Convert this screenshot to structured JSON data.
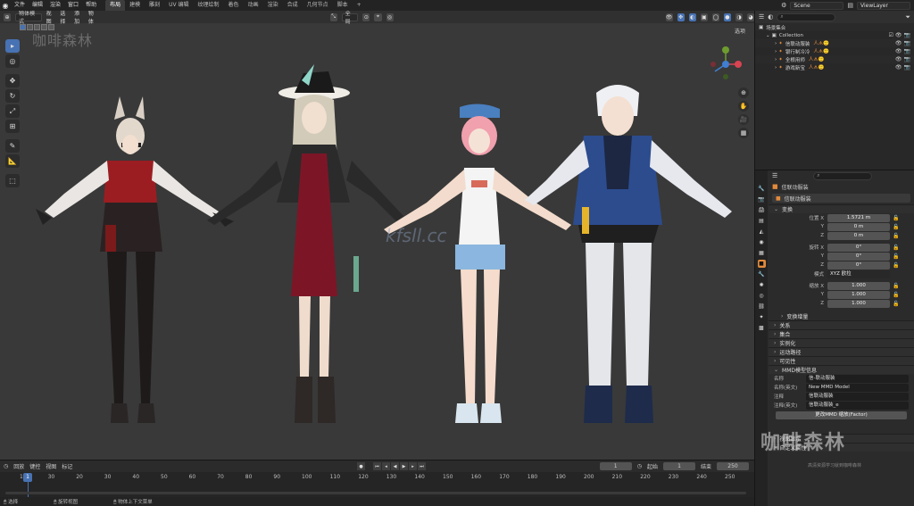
{
  "topbar": {
    "menu": [
      "文件",
      "编辑",
      "渲染",
      "窗口",
      "帮助"
    ],
    "workspaces": [
      "布局",
      "建模",
      "雕刻",
      "UV 编辑",
      "纹理绘制",
      "着色",
      "动画",
      "渲染",
      "合成",
      "几何节点",
      "脚本"
    ],
    "active_workspace": "布局",
    "scene": "Scene",
    "view_layer": "ViewLayer"
  },
  "viewport": {
    "mode": "物体模式",
    "view_menu": [
      "视图",
      "选择",
      "添加",
      "物体"
    ],
    "orientation": "全局",
    "options_label": "选项",
    "watermark_cn": "咖啡森林",
    "watermark_url": "kfsll.cc"
  },
  "toolbar": {
    "tools": [
      "select-box",
      "cursor",
      "move",
      "rotate",
      "scale",
      "transform",
      "annotate",
      "measure",
      "add-cube"
    ]
  },
  "outliner": {
    "root": "场景集合",
    "collection": "Collection",
    "items": [
      {
        "name": "信联动服装",
        "tag": "人ᗑ🙂"
      },
      {
        "name": "银行制冷冷",
        "tag": "人ᗑ🙂"
      },
      {
        "name": "全根用师",
        "tag": "人ᗑ🙂"
      },
      {
        "name": "游戏新宝",
        "tag": "人ᗑ🙂"
      }
    ]
  },
  "properties": {
    "object_name": "信联动服装",
    "object_field": "信联动服装",
    "transform_title": "变换",
    "location_label": "位置 X",
    "location": [
      "1.5721 m",
      "0 m",
      "0 m"
    ],
    "rotation_label": "旋转 X",
    "rotation": [
      "0°",
      "0°",
      "0°"
    ],
    "mode_label": "模式",
    "rotation_mode": "XYZ 欧拉",
    "scale_label": "缩放 X",
    "scale": [
      "1.000",
      "1.000",
      "1.000"
    ],
    "delta_title": "变换增量",
    "collapsed_panels": [
      "关系",
      "集合",
      "实例化",
      "运动路径",
      "可见性"
    ],
    "mmd_title": "MMD模型信息",
    "mmd_name_label": "名称",
    "mmd_name": "信-联动服装",
    "mmd_en_label": "名称(英文)",
    "mmd_en": "New MMD Model",
    "mmd_comment_label": "注释",
    "mmd_comment": "信联动服装",
    "mmd_comment_en_label": "注释(英文)",
    "mmd_comment_en": "信联动服装_e",
    "mmd_button": "更改MMD 缩放(Factor)",
    "bottom_panels": [
      "视图显示",
      "自定义属性"
    ]
  },
  "timeline": {
    "menu": [
      "回放",
      "键控",
      "视图",
      "标记"
    ],
    "current_frame": "1",
    "start_label": "起始",
    "start": "1",
    "end_label": "结束",
    "end": "250",
    "ticks": [
      "1",
      "30",
      "20",
      "30",
      "40",
      "50",
      "60",
      "70",
      "80",
      "90",
      "100",
      "110",
      "120",
      "130",
      "140",
      "150",
      "160",
      "170",
      "180",
      "190",
      "200",
      "210",
      "220",
      "230",
      "240",
      "250"
    ]
  },
  "statusbar": {
    "items": [
      "选择",
      "旋转视图",
      "物体上下文菜单"
    ]
  },
  "watermark_bottom": "咖啡森林",
  "watermark_bottom_sub": "高清资源学习就到咖啡森林"
}
